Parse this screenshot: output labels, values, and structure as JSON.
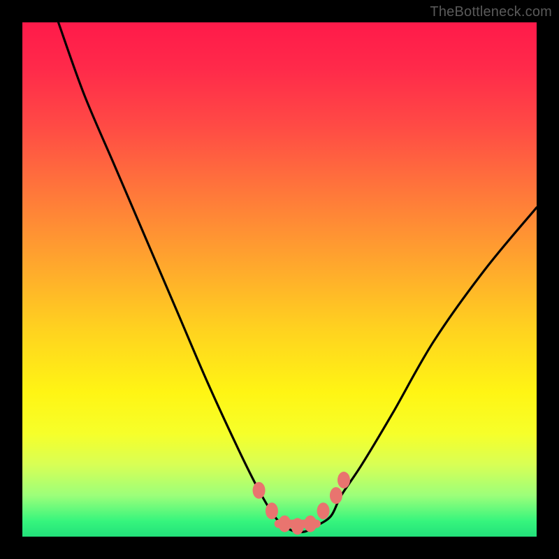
{
  "attribution": {
    "text": "TheBottleneck.com"
  },
  "chart_data": {
    "type": "line",
    "title": "",
    "xlabel": "",
    "ylabel": "",
    "xlim": [
      0,
      100
    ],
    "ylim": [
      0,
      100
    ],
    "series": [
      {
        "name": "bottleneck-curve",
        "x": [
          7,
          12,
          18,
          24,
          30,
          36,
          42,
          46,
          49,
          51,
          53,
          55,
          57,
          60,
          62,
          66,
          72,
          80,
          90,
          100
        ],
        "y": [
          100,
          86,
          72,
          58,
          44,
          30,
          17,
          9,
          4,
          2,
          1,
          1,
          2,
          4,
          8,
          14,
          24,
          38,
          52,
          64
        ]
      }
    ],
    "markers": {
      "name": "highlight-points",
      "x": [
        46,
        48.5,
        51,
        53.5,
        56,
        58.5,
        61,
        62.5
      ],
      "y": [
        9,
        5,
        2.5,
        2,
        2.5,
        5,
        8,
        11
      ]
    },
    "background_gradient": {
      "stops": [
        {
          "pos": 0,
          "color": "#ff1a4a"
        },
        {
          "pos": 50,
          "color": "#ffb12a"
        },
        {
          "pos": 80,
          "color": "#f6ff2a"
        },
        {
          "pos": 100,
          "color": "#22e07a"
        }
      ]
    }
  }
}
